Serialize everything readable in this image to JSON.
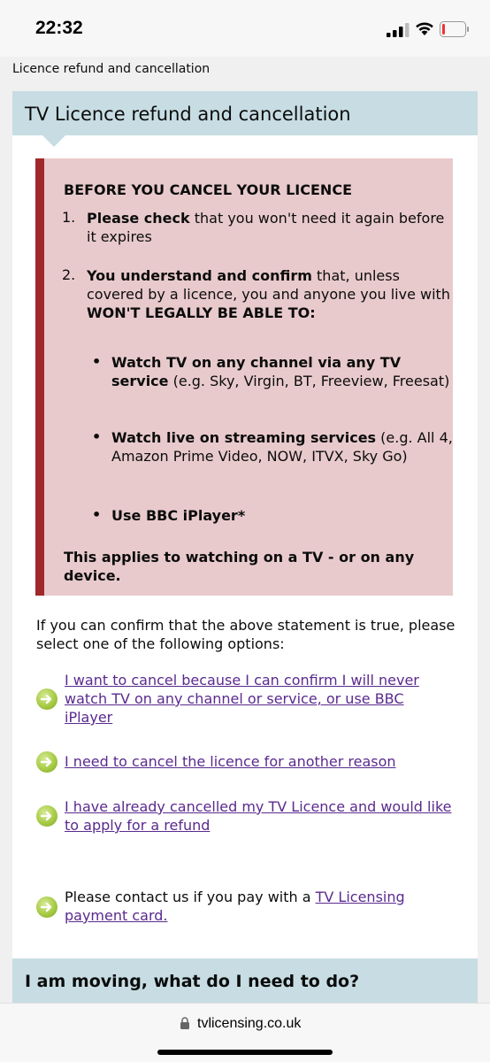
{
  "status_bar": {
    "time": "22:32"
  },
  "page": {
    "heading": "Licence refund and cancellation"
  },
  "card": {
    "title": "TV Licence refund and cancellation",
    "warning": {
      "title": "BEFORE YOU CANCEL YOUR LICENCE",
      "items": [
        {
          "number": "1.",
          "bold": "Please check",
          "rest": " that you won't need it again before it expires"
        },
        {
          "number": "2.",
          "bold": "You understand and confirm",
          "rest": " that, unless covered by a licence, you and anyone you live with ",
          "bold2": "WON'T LEGALLY BE ABLE TO:"
        }
      ],
      "bullets": [
        {
          "bold": "Watch TV on any channel via any TV service",
          "rest": " (e.g. Sky, Virgin, BT, Freeview, Freesat)"
        },
        {
          "bold": "Watch live on streaming services",
          "rest": " (e.g. All 4, Amazon Prime Video, NOW, ITVX, Sky Go)"
        },
        {
          "bold": "Use BBC iPlayer*",
          "rest": ""
        }
      ],
      "footer": "This applies to watching on a TV - or on any device."
    },
    "intro": "If you can confirm that the above statement is true, please select one of the following options:",
    "options": [
      "I want to cancel because I can confirm I will never watch TV on any channel or service, or use BBC iPlayer",
      "I need to cancel the licence for another reason",
      "I have already cancelled my TV Licence and would like to apply for a refund"
    ],
    "contact": {
      "text": "Please contact us if you pay with a ",
      "link": "TV Licensing payment card."
    },
    "moving_title": "I am moving, what do I need to do?"
  },
  "browser": {
    "url": "tvlicensing.co.uk"
  },
  "colors": {
    "header_bg": "#c7dde3",
    "warning_bg": "#e9cacc",
    "warning_border": "#a0282b",
    "link": "#5a2a8e",
    "icon_green": "#a7cb45"
  }
}
